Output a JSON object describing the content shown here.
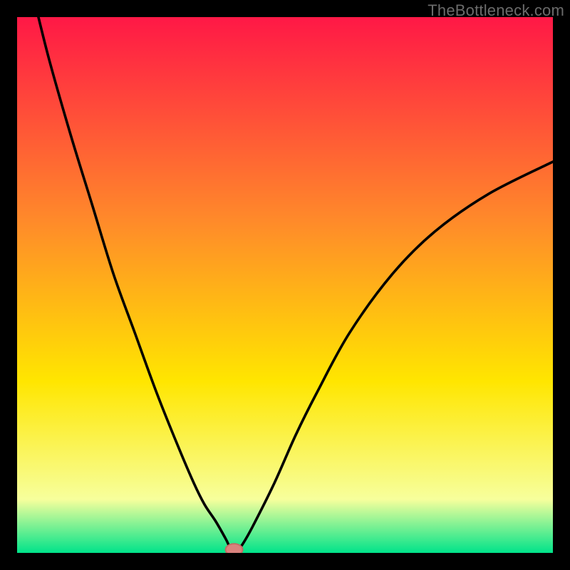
{
  "watermark": "TheBottleneck.com",
  "colors": {
    "gradient_top": "#ff1846",
    "gradient_mid1": "#ff8a2a",
    "gradient_mid2": "#ffe600",
    "gradient_low": "#f7ff9c",
    "gradient_bottom": "#00e38a",
    "curve": "#000000",
    "marker_fill": "#d9827d",
    "marker_stroke": "#c46a64",
    "frame_bg": "#000000"
  },
  "chart_data": {
    "type": "line",
    "title": "",
    "xlabel": "",
    "ylabel": "",
    "xlim": [
      0,
      100
    ],
    "ylim": [
      0,
      100
    ],
    "legend": false,
    "grid": false,
    "notes": "V-shaped bottleneck curve on a vertical rainbow gradient. The curve reaches the baseline at roughly x ≈ 40.5 with a small flat segment; a rounded pink marker sits at the minimum.",
    "series": [
      {
        "name": "bottleneck_curve",
        "x": [
          0,
          3,
          6,
          10,
          14,
          18,
          22,
          26,
          30,
          33,
          35,
          37,
          39,
          40,
          41,
          42,
          44,
          48,
          52,
          56,
          62,
          70,
          78,
          88,
          100
        ],
        "y": [
          116,
          104,
          92,
          78,
          65,
          52,
          41,
          30,
          20,
          13,
          9,
          6,
          2.5,
          0.5,
          0.5,
          1.5,
          5,
          13,
          22,
          30,
          41,
          52,
          60,
          67,
          73
        ]
      }
    ],
    "marker": {
      "x": 40.5,
      "y": 0.6,
      "rx": 1.6,
      "ry": 1.1
    }
  }
}
